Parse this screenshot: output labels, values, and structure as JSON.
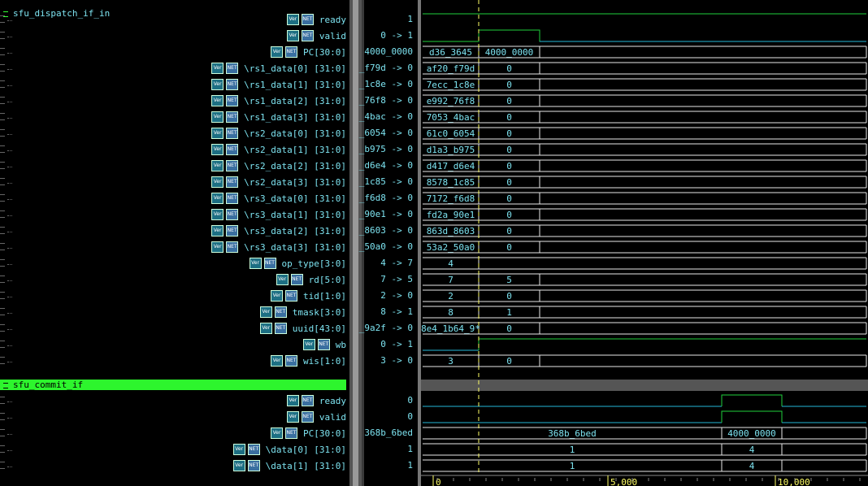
{
  "groups": [
    {
      "title": "sfu_dispatch_if_in"
    },
    {
      "title": "sfu_commit_if"
    }
  ],
  "badges": {
    "verilog": "Ver",
    "net": "NET"
  },
  "dispatch_signals": [
    {
      "name": "ready",
      "value": "1"
    },
    {
      "name": "valid",
      "value": "0 -> 1"
    },
    {
      "name": "PC[30:0]",
      "value": "4000_0000"
    },
    {
      "name": "\\rs1_data[0] [31:0]",
      "value": "_f79d -> 0"
    },
    {
      "name": "\\rs1_data[1] [31:0]",
      "value": "_1c8e -> 0"
    },
    {
      "name": "\\rs1_data[2] [31:0]",
      "value": "_76f8 -> 0"
    },
    {
      "name": "\\rs1_data[3] [31:0]",
      "value": "_4bac -> 0"
    },
    {
      "name": "\\rs2_data[0] [31:0]",
      "value": "_6054 -> 0"
    },
    {
      "name": "\\rs2_data[1] [31:0]",
      "value": "_b975 -> 0"
    },
    {
      "name": "\\rs2_data[2] [31:0]",
      "value": "_d6e4 -> 0"
    },
    {
      "name": "\\rs2_data[3] [31:0]",
      "value": "_1c85 -> 0"
    },
    {
      "name": "\\rs3_data[0] [31:0]",
      "value": "_f6d8 -> 0"
    },
    {
      "name": "\\rs3_data[1] [31:0]",
      "value": "_90e1 -> 0"
    },
    {
      "name": "\\rs3_data[2] [31:0]",
      "value": "_8603 -> 0"
    },
    {
      "name": "\\rs3_data[3] [31:0]",
      "value": "_50a0 -> 0"
    },
    {
      "name": "op_type[3:0]",
      "value": "4 -> 7"
    },
    {
      "name": "rd[5:0]",
      "value": "7 -> 5"
    },
    {
      "name": "tid[1:0]",
      "value": "2 -> 0"
    },
    {
      "name": "tmask[3:0]",
      "value": "8 -> 1"
    },
    {
      "name": "uuid[43:0]",
      "value": "_9a2f -> 0"
    },
    {
      "name": "wb",
      "value": "0 -> 1"
    },
    {
      "name": "wis[1:0]",
      "value": "3 -> 0"
    }
  ],
  "commit_signals": [
    {
      "name": "ready",
      "value": "0"
    },
    {
      "name": "valid",
      "value": "0"
    },
    {
      "name": "PC[30:0]",
      "value": "368b_6bed"
    },
    {
      "name": "\\data[0] [31:0]",
      "value": "1"
    },
    {
      "name": "\\data[1] [31:0]",
      "value": "1"
    }
  ],
  "dispatch_waves": [
    {
      "kind": "bit",
      "level": "high"
    },
    {
      "kind": "pulse",
      "before": "0",
      "after": "1",
      "after_end": "0"
    },
    {
      "kind": "bus",
      "segs": [
        "d36_3645",
        "4000_0000"
      ]
    },
    {
      "kind": "bus",
      "segs": [
        "af20_f79d",
        "0"
      ]
    },
    {
      "kind": "bus",
      "segs": [
        "7ecc_1c8e",
        "0"
      ]
    },
    {
      "kind": "bus",
      "segs": [
        "e992_76f8",
        "0"
      ]
    },
    {
      "kind": "bus",
      "segs": [
        "7053_4bac",
        "0"
      ]
    },
    {
      "kind": "bus",
      "segs": [
        "61c0_6054",
        "0"
      ]
    },
    {
      "kind": "bus",
      "segs": [
        "d1a3_b975",
        "0"
      ]
    },
    {
      "kind": "bus",
      "segs": [
        "d417_d6e4",
        "0"
      ]
    },
    {
      "kind": "bus",
      "segs": [
        "8578_1c85",
        "0"
      ]
    },
    {
      "kind": "bus",
      "segs": [
        "7172_f6d8",
        "0"
      ]
    },
    {
      "kind": "bus",
      "segs": [
        "fd2a_90e1",
        "0"
      ]
    },
    {
      "kind": "bus",
      "segs": [
        "863d_8603",
        "0"
      ]
    },
    {
      "kind": "bus",
      "segs": [
        "53a2_50a0",
        "0"
      ]
    },
    {
      "kind": "bus1",
      "segs": [
        "4"
      ]
    },
    {
      "kind": "bus",
      "segs": [
        "7",
        "5"
      ]
    },
    {
      "kind": "bus",
      "segs": [
        "2",
        "0"
      ]
    },
    {
      "kind": "bus",
      "segs": [
        "8",
        "1"
      ]
    },
    {
      "kind": "bus",
      "segs": [
        "8e4_1b64_9*",
        "0"
      ]
    },
    {
      "kind": "step",
      "before": "0",
      "after": "1"
    },
    {
      "kind": "bus",
      "segs": [
        "3",
        "0"
      ]
    }
  ],
  "commit_waves": [
    {
      "kind": "cpulse"
    },
    {
      "kind": "cpulse"
    },
    {
      "kind": "cbus",
      "segs": [
        "368b_6bed",
        "4000_0000"
      ]
    },
    {
      "kind": "cbus",
      "segs": [
        "1",
        "4"
      ]
    },
    {
      "kind": "cbus",
      "segs": [
        "1",
        "4"
      ]
    }
  ],
  "ruler": {
    "labels": [
      "0",
      "5,000",
      "10,000"
    ]
  },
  "colors": {
    "wave": "#1fcf3c",
    "bus_edge": "#e8e8e8",
    "low": "#25b8d8",
    "cursor": "#ffff66",
    "group_sel": "#2df52d"
  }
}
